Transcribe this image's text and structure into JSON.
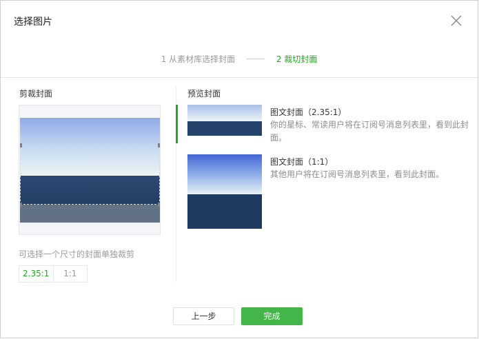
{
  "dialog": {
    "title": "选择图片",
    "close_icon": "close-icon"
  },
  "steps": [
    {
      "label": "1 从素材库选择封面",
      "state": "inactive"
    },
    {
      "label": "2 裁切封面",
      "state": "active"
    }
  ],
  "crop_panel": {
    "label": "剪裁封面",
    "hint": "可选择一个尺寸的封面单独裁剪",
    "ratios": [
      {
        "label": "2.35:1",
        "active": true
      },
      {
        "label": "1:1",
        "active": false
      }
    ]
  },
  "preview_panel": {
    "label": "预览封面",
    "items": [
      {
        "title": "图文封面（2.35:1）",
        "desc": "你的星标、常读用户将在订阅号消息列表里，看到此封面。"
      },
      {
        "title": "图文封面（1:1）",
        "desc": "其他用户将在订阅号消息列表里，看到此封面。"
      }
    ]
  },
  "footer": {
    "prev_label": "上一步",
    "done_label": "完成"
  },
  "colors": {
    "accent": "#1aad19",
    "primary_button": "#44b549"
  }
}
